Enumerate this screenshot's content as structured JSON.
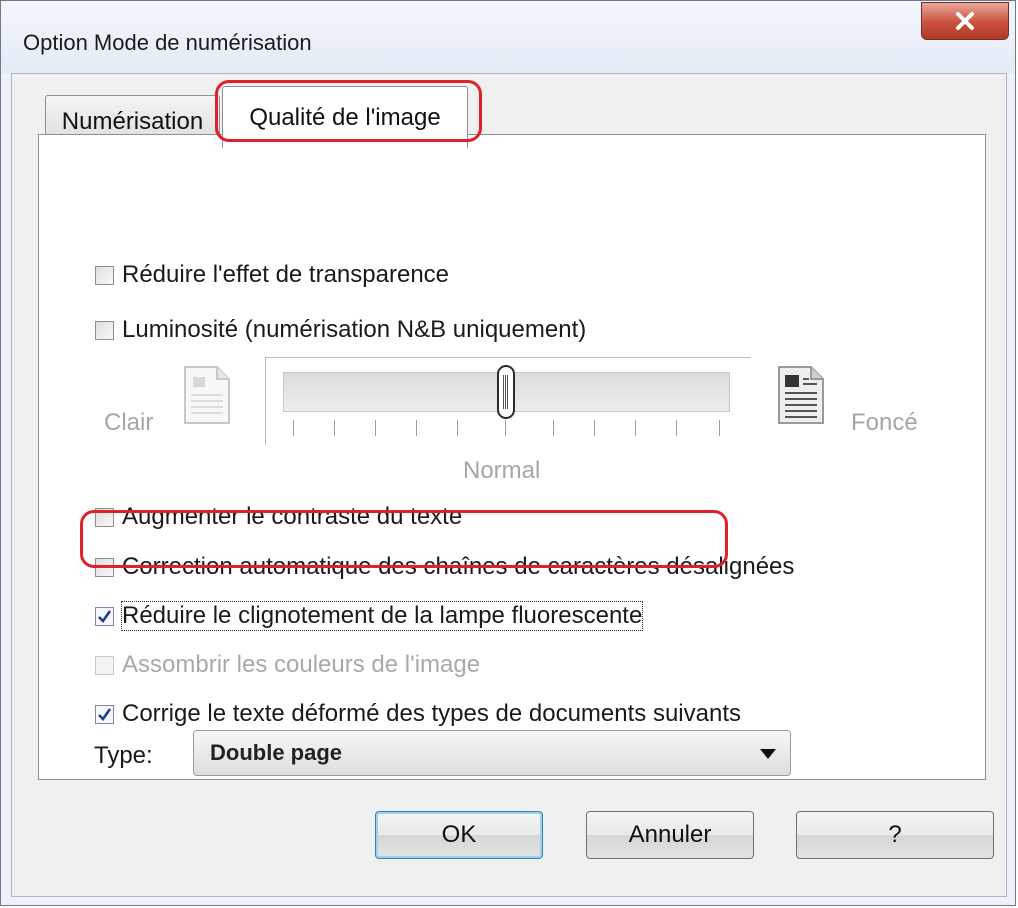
{
  "window": {
    "title": "Option Mode de numérisation",
    "close_label": "X"
  },
  "tabs": [
    {
      "label": "Numérisation"
    },
    {
      "label": "Qualité de l'image"
    }
  ],
  "options": {
    "reduce_transparency": {
      "label": "Réduire l'effet de transparence",
      "checked": false
    },
    "brightness": {
      "label": "Luminosité (numérisation N&B uniquement)",
      "checked": false
    },
    "increase_contrast": {
      "label": "Augmenter le contraste du texte",
      "checked": false
    },
    "auto_correct_skew": {
      "label": "Correction automatique des chaînes de caractères désalignées",
      "checked": false
    },
    "reduce_flicker": {
      "label": "Réduire le clignotement de la lampe fluorescente",
      "checked": true
    },
    "darken_colors": {
      "label": "Assombrir les couleurs de l'image",
      "checked": false,
      "disabled": true
    },
    "correct_distorted_text": {
      "label": "Corrige le texte déformé des types de documents suivants",
      "checked": true
    }
  },
  "brightness_slider": {
    "light_label": "Clair",
    "dark_label": "Foncé",
    "center_label": "Normal",
    "value": 0.5,
    "tick_count": 11,
    "disabled": true
  },
  "type": {
    "label": "Type:",
    "value": "Double page"
  },
  "buttons": {
    "ok": "OK",
    "cancel": "Annuler",
    "help": "?"
  },
  "colors": {
    "highlight": "#e0202b",
    "close_button": "#c9503c",
    "default_button_border": "#3c7fb1"
  }
}
